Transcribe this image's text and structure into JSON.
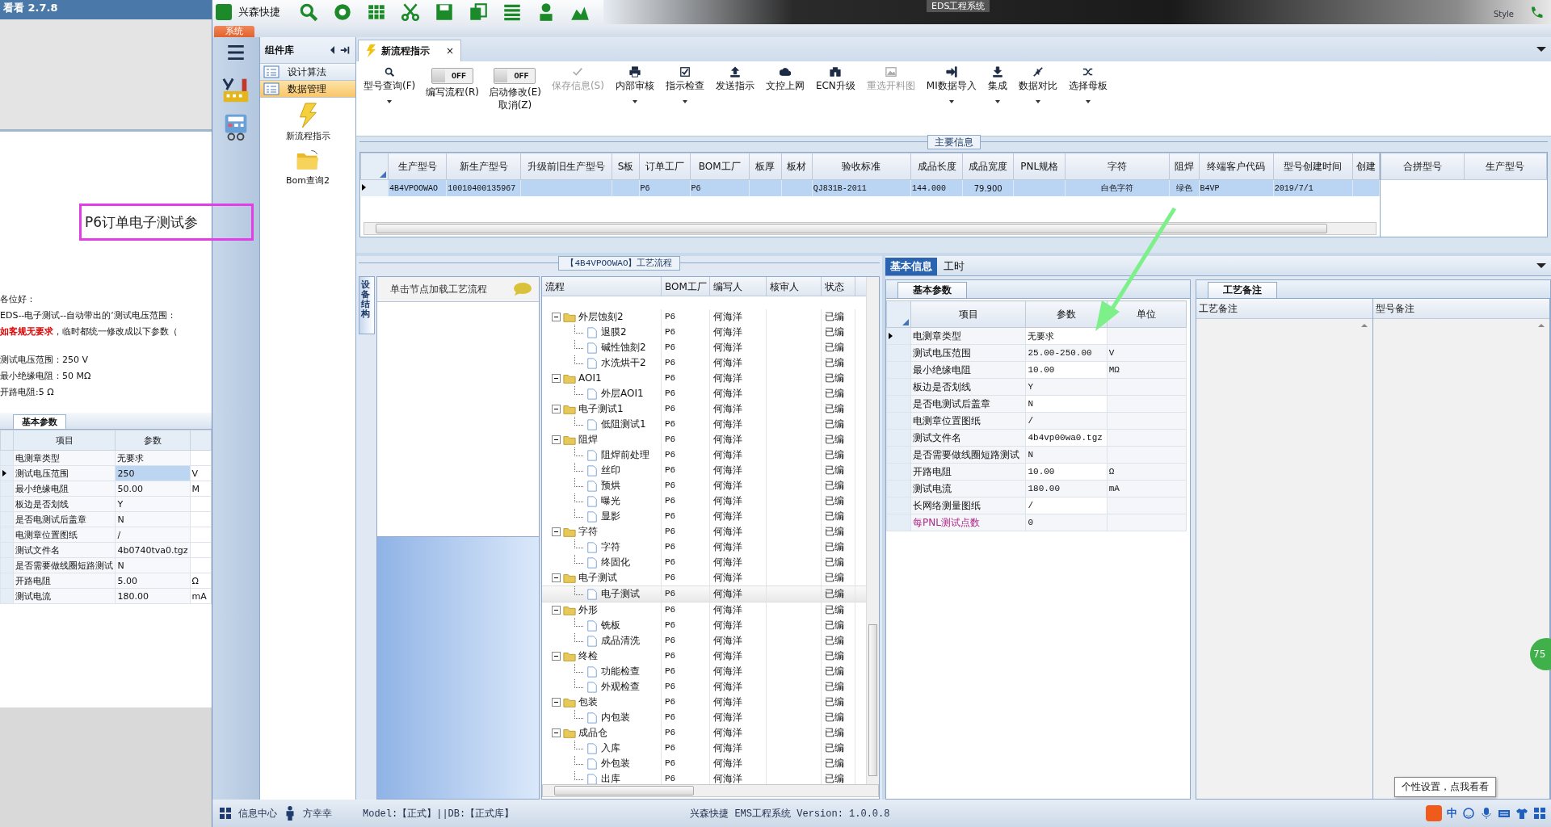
{
  "viewer": {
    "title": "看看 2.7.8",
    "highlight": "P6订单电子测试参",
    "paragraphs": [
      "各位好：",
      "EDS--电子测试--自动带出的‘测试电压范围：",
      "**如客规无要求**，临时都统一修改成以下参数（"
    ],
    "values": [
      "测试电压范围：250 V",
      "最小绝缘电阻：50 MΩ",
      "开路电阻:5 Ω"
    ],
    "tab": "基本参数",
    "columns": [
      "项目",
      "参数"
    ],
    "rows": [
      {
        "item": "电测章类型",
        "value": "无要求",
        "unit": "",
        "selected": false
      },
      {
        "item": "测试电压范围",
        "value": "250",
        "unit": "V",
        "selected": true
      },
      {
        "item": "最小绝缘电阻",
        "value": "50.00",
        "unit": "M",
        "selected": false
      },
      {
        "item": "板边是否划线",
        "value": "Y",
        "unit": "",
        "selected": false
      },
      {
        "item": "是否电测试后盖章",
        "value": "N",
        "unit": "",
        "selected": false
      },
      {
        "item": "电测章位置图纸",
        "value": "/",
        "unit": "",
        "selected": false
      },
      {
        "item": "测试文件名",
        "value": "4b0740tva0.tgz",
        "unit": "",
        "selected": false
      },
      {
        "item": "是否需要做线圈短路测试",
        "value": "N",
        "unit": "",
        "selected": false
      },
      {
        "item": "开路电阻",
        "value": "5.00",
        "unit": "Ω",
        "selected": false
      },
      {
        "item": "测试电流",
        "value": "180.00",
        "unit": "mA",
        "selected": false
      }
    ]
  },
  "app": {
    "name": "兴森快捷",
    "caption": "EDS工程系统",
    "style_label": "Style",
    "menu_tab": "系统",
    "badge": "75"
  },
  "library": {
    "title": "组件库",
    "groups": [
      {
        "label": "设计算法",
        "selected": false
      },
      {
        "label": "数据管理",
        "selected": true
      }
    ],
    "tools": [
      "新流程指示",
      "Bom查询2"
    ]
  },
  "doc_tab": {
    "label": "新流程指示",
    "close": "×"
  },
  "toolbar": [
    {
      "kind": "button",
      "label": "型号查询(F)",
      "disabled": false,
      "dropdown": true
    },
    {
      "kind": "toggle",
      "label": "编写流程(R)",
      "state_text": "OFF",
      "on": false
    },
    {
      "kind": "toggle",
      "label": "启动修改(E)\n取消(Z)",
      "state_text": "OFF",
      "on": false
    },
    {
      "kind": "button",
      "label": "保存信息(S)",
      "disabled": true,
      "dropdown": false
    },
    {
      "kind": "button",
      "label": "内部审核",
      "disabled": false,
      "dropdown": true
    },
    {
      "kind": "button",
      "label": "指示检查",
      "disabled": false,
      "dropdown": true
    },
    {
      "kind": "button",
      "label": "发送指示",
      "disabled": false,
      "dropdown": false
    },
    {
      "kind": "button",
      "label": "文控上网",
      "disabled": false,
      "dropdown": false
    },
    {
      "kind": "button",
      "label": "ECN升级",
      "disabled": false,
      "dropdown": false
    },
    {
      "kind": "button",
      "label": "重选开料图",
      "disabled": true,
      "dropdown": false
    },
    {
      "kind": "button",
      "label": "MI数据导入",
      "disabled": false,
      "dropdown": true
    },
    {
      "kind": "button",
      "label": "集成",
      "disabled": false,
      "dropdown": true
    },
    {
      "kind": "button",
      "label": "数据对比",
      "disabled": false,
      "dropdown": true
    },
    {
      "kind": "button",
      "label": "选择母板",
      "disabled": false,
      "dropdown": true
    }
  ],
  "main_info": {
    "title": "主要信息",
    "columns": [
      "生产型号",
      "新生产型号",
      "升级前旧生产型号",
      "S板",
      "订单工厂",
      "BOM工厂",
      "板厚",
      "板材",
      "验收标准",
      "成品长度",
      "成品宽度",
      "PNL规格",
      "字符",
      "阻焊",
      "终端客户代码",
      "型号创建时间",
      "创建"
    ],
    "rows": [
      {
        "selected": true,
        "cells": [
          "4B4VPOOWAO",
          "10010400135967",
          "",
          "",
          "P6",
          "P6",
          "",
          "",
          "QJ831B-2011",
          "144.000",
          "79.900",
          "",
          "白色字符",
          "绿色",
          "B4VP",
          "2019/7/1",
          ""
        ]
      }
    ],
    "side_columns": [
      "合拼型号",
      "生产型号"
    ]
  },
  "flow": {
    "title": "【4B4VPOOWAO】工艺流程",
    "side_tab": "设备结构",
    "hint": "单击节点加载工艺流程",
    "columns": [
      "流程",
      "BOM工厂",
      "编写人",
      "核审人",
      "状态"
    ],
    "tree": [
      {
        "label": "外层蚀刻2",
        "bom": "P6",
        "writer": "何海洋",
        "status": "已编",
        "expanded": true,
        "selected": false,
        "children": [
          {
            "label": "退膜2",
            "bom": "P6",
            "writer": "何海洋",
            "status": "已编",
            "selected": false
          },
          {
            "label": "碱性蚀刻2",
            "bom": "P6",
            "writer": "何海洋",
            "status": "已编",
            "selected": false
          },
          {
            "label": "水洗烘干2",
            "bom": "P6",
            "writer": "何海洋",
            "status": "已编",
            "selected": false
          }
        ]
      },
      {
        "label": "AOI1",
        "bom": "P6",
        "writer": "何海洋",
        "status": "已编",
        "expanded": true,
        "selected": false,
        "children": [
          {
            "label": "外层AOI1",
            "bom": "P6",
            "writer": "何海洋",
            "status": "已编",
            "selected": false
          }
        ]
      },
      {
        "label": "电子测试1",
        "bom": "P6",
        "writer": "何海洋",
        "status": "已编",
        "expanded": true,
        "selected": false,
        "children": [
          {
            "label": "低阻测试1",
            "bom": "P6",
            "writer": "何海洋",
            "status": "已编",
            "selected": false
          }
        ]
      },
      {
        "label": "阻焊",
        "bom": "P6",
        "writer": "何海洋",
        "status": "已编",
        "expanded": true,
        "selected": false,
        "children": [
          {
            "label": "阻焊前处理",
            "bom": "P6",
            "writer": "何海洋",
            "status": "已编",
            "selected": false
          },
          {
            "label": "丝印",
            "bom": "P6",
            "writer": "何海洋",
            "status": "已编",
            "selected": false
          },
          {
            "label": "预烘",
            "bom": "P6",
            "writer": "何海洋",
            "status": "已编",
            "selected": false
          },
          {
            "label": "曝光",
            "bom": "P6",
            "writer": "何海洋",
            "status": "已编",
            "selected": false
          },
          {
            "label": "显影",
            "bom": "P6",
            "writer": "何海洋",
            "status": "已编",
            "selected": false
          }
        ]
      },
      {
        "label": "字符",
        "bom": "P6",
        "writer": "何海洋",
        "status": "已编",
        "expanded": true,
        "selected": false,
        "children": [
          {
            "label": "字符",
            "bom": "P6",
            "writer": "何海洋",
            "status": "已编",
            "selected": false
          },
          {
            "label": "终固化",
            "bom": "P6",
            "writer": "何海洋",
            "status": "已编",
            "selected": false
          }
        ]
      },
      {
        "label": "电子测试",
        "bom": "P6",
        "writer": "何海洋",
        "status": "已编",
        "expanded": true,
        "selected": false,
        "children": [
          {
            "label": "电子测试",
            "bom": "P6",
            "writer": "何海洋",
            "status": "已编",
            "selected": true
          }
        ]
      },
      {
        "label": "外形",
        "bom": "P6",
        "writer": "何海洋",
        "status": "已编",
        "expanded": true,
        "selected": false,
        "children": [
          {
            "label": "铣板",
            "bom": "P6",
            "writer": "何海洋",
            "status": "已编",
            "selected": false
          },
          {
            "label": "成品清洗",
            "bom": "P6",
            "writer": "何海洋",
            "status": "已编",
            "selected": false
          }
        ]
      },
      {
        "label": "终检",
        "bom": "P6",
        "writer": "何海洋",
        "status": "已编",
        "expanded": true,
        "selected": false,
        "children": [
          {
            "label": "功能检查",
            "bom": "P6",
            "writer": "何海洋",
            "status": "已编",
            "selected": false
          },
          {
            "label": "外观检查",
            "bom": "P6",
            "writer": "何海洋",
            "status": "已编",
            "selected": false
          }
        ]
      },
      {
        "label": "包装",
        "bom": "P6",
        "writer": "何海洋",
        "status": "已编",
        "expanded": true,
        "selected": false,
        "children": [
          {
            "label": "内包装",
            "bom": "P6",
            "writer": "何海洋",
            "status": "已编",
            "selected": false
          }
        ]
      },
      {
        "label": "成品仓",
        "bom": "P6",
        "writer": "何海洋",
        "status": "已编",
        "expanded": true,
        "selected": false,
        "children": [
          {
            "label": "入库",
            "bom": "P6",
            "writer": "何海洋",
            "status": "已编",
            "selected": false
          },
          {
            "label": "外包装",
            "bom": "P6",
            "writer": "何海洋",
            "status": "已编",
            "selected": false
          },
          {
            "label": "出库",
            "bom": "P6",
            "writer": "何海洋",
            "status": "已编",
            "selected": false
          }
        ]
      }
    ]
  },
  "detail": {
    "tabs": [
      {
        "label": "基本信息",
        "selected": true
      },
      {
        "label": "工时",
        "selected": false
      }
    ],
    "params_tab": "基本参数",
    "columns": [
      "项目",
      "参数",
      "单位"
    ],
    "rows": [
      {
        "item": "电测章类型",
        "value": "无要求",
        "unit": "",
        "selected": true,
        "flagged": false
      },
      {
        "item": "测试电压范围",
        "value": "25.00-250.00",
        "unit": "V",
        "selected": false,
        "flagged": false
      },
      {
        "item": "最小绝缘电阻",
        "value": "10.00",
        "unit": "MΩ",
        "selected": false,
        "flagged": false
      },
      {
        "item": "板边是否划线",
        "value": "Y",
        "unit": "",
        "selected": false,
        "flagged": false
      },
      {
        "item": "是否电测试后盖章",
        "value": "N",
        "unit": "",
        "selected": false,
        "flagged": false
      },
      {
        "item": "电测章位置图纸",
        "value": "/",
        "unit": "",
        "selected": false,
        "flagged": false
      },
      {
        "item": "测试文件名",
        "value": "4b4vp00wa0.tgz",
        "unit": "",
        "selected": false,
        "flagged": false
      },
      {
        "item": "是否需要做线圈短路测试",
        "value": "N",
        "unit": "",
        "selected": false,
        "flagged": false
      },
      {
        "item": "开路电阻",
        "value": "10.00",
        "unit": "Ω",
        "selected": false,
        "flagged": false
      },
      {
        "item": "测试电流",
        "value": "180.00",
        "unit": "mA",
        "selected": false,
        "flagged": false
      },
      {
        "item": "长网络测量图纸",
        "value": "/",
        "unit": "",
        "selected": false,
        "flagged": false
      },
      {
        "item": "每PNL测试点数",
        "value": "0",
        "unit": "",
        "selected": false,
        "flagged": true
      }
    ],
    "notes_tab": "工艺备注",
    "notes_columns": [
      "工艺备注",
      "型号备注"
    ]
  },
  "status_bar": {
    "items": [
      "信息中心",
      "方幸幸"
    ],
    "model": "Model:【正式】||DB:【正式库】",
    "version": "兴森快捷 EMS工程系统 Version: 1.0.0.8",
    "tooltip": "个性设置，点我看看",
    "ime": "中"
  }
}
